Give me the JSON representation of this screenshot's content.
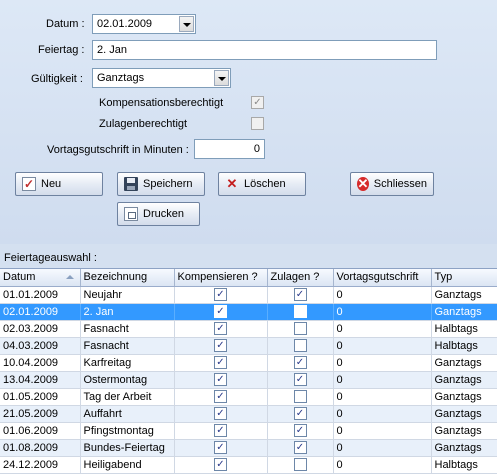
{
  "form": {
    "datum_label": "Datum :",
    "datum_value": "02.01.2009",
    "feiertag_label": "Feiertag :",
    "feiertag_value": "2. Jan",
    "gueltigkeit_label": "Gültigkeit :",
    "gueltigkeit_value": "Ganztags",
    "kompensation_label": "Kompensationsberechtigt",
    "kompensation_checked": true,
    "zulagen_label": "Zulagenberechtigt",
    "zulagen_checked": false,
    "vortag_label": "Vortagsgutschrift in Minuten :",
    "vortag_value": "0"
  },
  "buttons": {
    "neu": "Neu",
    "speichern": "Speichern",
    "loeschen": "Löschen",
    "schliessen": "Schliessen",
    "drucken": "Drucken"
  },
  "grid": {
    "section_label": "Feiertageauswahl :",
    "columns": [
      "Datum",
      "Bezeichnung",
      "Kompensieren ?",
      "Zulagen ?",
      "Vortagsgutschrift",
      "Typ"
    ],
    "selected_index": 1,
    "rows": [
      {
        "datum": "01.01.2009",
        "bezeichnung": "Neujahr",
        "kompensieren": true,
        "zulagen": true,
        "vortag": "0",
        "typ": "Ganztags"
      },
      {
        "datum": "02.01.2009",
        "bezeichnung": "2. Jan",
        "kompensieren": true,
        "zulagen": false,
        "vortag": "0",
        "typ": "Ganztags"
      },
      {
        "datum": "02.03.2009",
        "bezeichnung": "Fasnacht",
        "kompensieren": true,
        "zulagen": false,
        "vortag": "0",
        "typ": "Halbtags"
      },
      {
        "datum": "04.03.2009",
        "bezeichnung": "Fasnacht",
        "kompensieren": true,
        "zulagen": false,
        "vortag": "0",
        "typ": "Halbtags"
      },
      {
        "datum": "10.04.2009",
        "bezeichnung": "Karfreitag",
        "kompensieren": true,
        "zulagen": true,
        "vortag": "0",
        "typ": "Ganztags"
      },
      {
        "datum": "13.04.2009",
        "bezeichnung": "Ostermontag",
        "kompensieren": true,
        "zulagen": true,
        "vortag": "0",
        "typ": "Ganztags"
      },
      {
        "datum": "01.05.2009",
        "bezeichnung": "Tag der Arbeit",
        "kompensieren": true,
        "zulagen": false,
        "vortag": "0",
        "typ": "Ganztags"
      },
      {
        "datum": "21.05.2009",
        "bezeichnung": "Auffahrt",
        "kompensieren": true,
        "zulagen": true,
        "vortag": "0",
        "typ": "Ganztags"
      },
      {
        "datum": "01.06.2009",
        "bezeichnung": "Pfingstmontag",
        "kompensieren": true,
        "zulagen": true,
        "vortag": "0",
        "typ": "Ganztags"
      },
      {
        "datum": "01.08.2009",
        "bezeichnung": "Bundes-Feiertag",
        "kompensieren": true,
        "zulagen": true,
        "vortag": "0",
        "typ": "Ganztags"
      },
      {
        "datum": "24.12.2009",
        "bezeichnung": "Heiligabend",
        "kompensieren": true,
        "zulagen": false,
        "vortag": "0",
        "typ": "Halbtags"
      }
    ]
  }
}
